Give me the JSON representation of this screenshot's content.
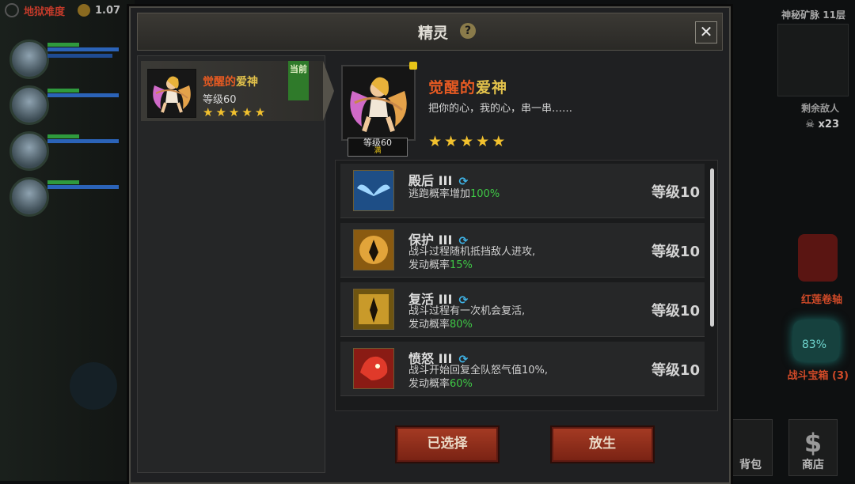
{
  "hud": {
    "difficulty": "地狱难度",
    "coins": "1.07"
  },
  "map": {
    "title": "神秘矿脉 11层",
    "enemy_label": "剩余敌人",
    "enemy_count": "x23"
  },
  "side": {
    "scroll_label": "红莲卷轴",
    "chest_pct": "83%",
    "chest_label": "战斗宝箱 (3)",
    "bag_label": "背包",
    "shop_label": "商店"
  },
  "modal": {
    "title": "精灵",
    "help": "?",
    "close": "✕"
  },
  "sprite_list": [
    {
      "name_a": "觉醒的",
      "name_b": "爱神",
      "level": "等级60",
      "stars": 5,
      "tag": "当前"
    }
  ],
  "detail": {
    "name_a": "觉醒的",
    "name_b": "爱神",
    "desc": "把你的心，我的心，串一串……",
    "level_tag": "等级60",
    "level_max": "满",
    "stars": 5
  },
  "skills": [
    {
      "name": "殿后",
      "rank": "III",
      "line1_pre": "逃跑概率增加",
      "line1_hl": "100%",
      "line1_post": "",
      "line2_pre": "",
      "line2_hl": "",
      "line2_post": "",
      "level": "等级10",
      "icon": "wings-icon",
      "color": "#1e4e86"
    },
    {
      "name": "保护",
      "rank": "III",
      "line1_pre": "战斗过程随机抵挡敌人进攻,",
      "line1_hl": "",
      "line1_post": "",
      "line2_pre": "发动概率",
      "line2_hl": "15%",
      "line2_post": "",
      "level": "等级10",
      "icon": "shield-figure-icon",
      "color": "#8a5a10"
    },
    {
      "name": "复活",
      "rank": "III",
      "line1_pre": "战斗过程有一次机会复活,",
      "line1_hl": "",
      "line1_post": "",
      "line2_pre": "发动概率",
      "line2_hl": "80%",
      "line2_post": "",
      "level": "等级10",
      "icon": "revive-figure-icon",
      "color": "#6e5410"
    },
    {
      "name": "愤怒",
      "rank": "III",
      "line1_pre": "战斗开始回复全队怒气值10%,",
      "line1_hl": "",
      "line1_post": "",
      "line2_pre": "发动概率",
      "line2_hl": "60%",
      "line2_post": "",
      "level": "等级10",
      "icon": "beast-rage-icon",
      "color": "#8a1b14"
    }
  ],
  "buttons": {
    "selected": "已选择",
    "release": "放生"
  },
  "colors": {
    "accent_orange": "#e65a22",
    "accent_gold": "#e2c14b",
    "highlight_green": "#3fc946",
    "button_red": "#a43a23"
  }
}
